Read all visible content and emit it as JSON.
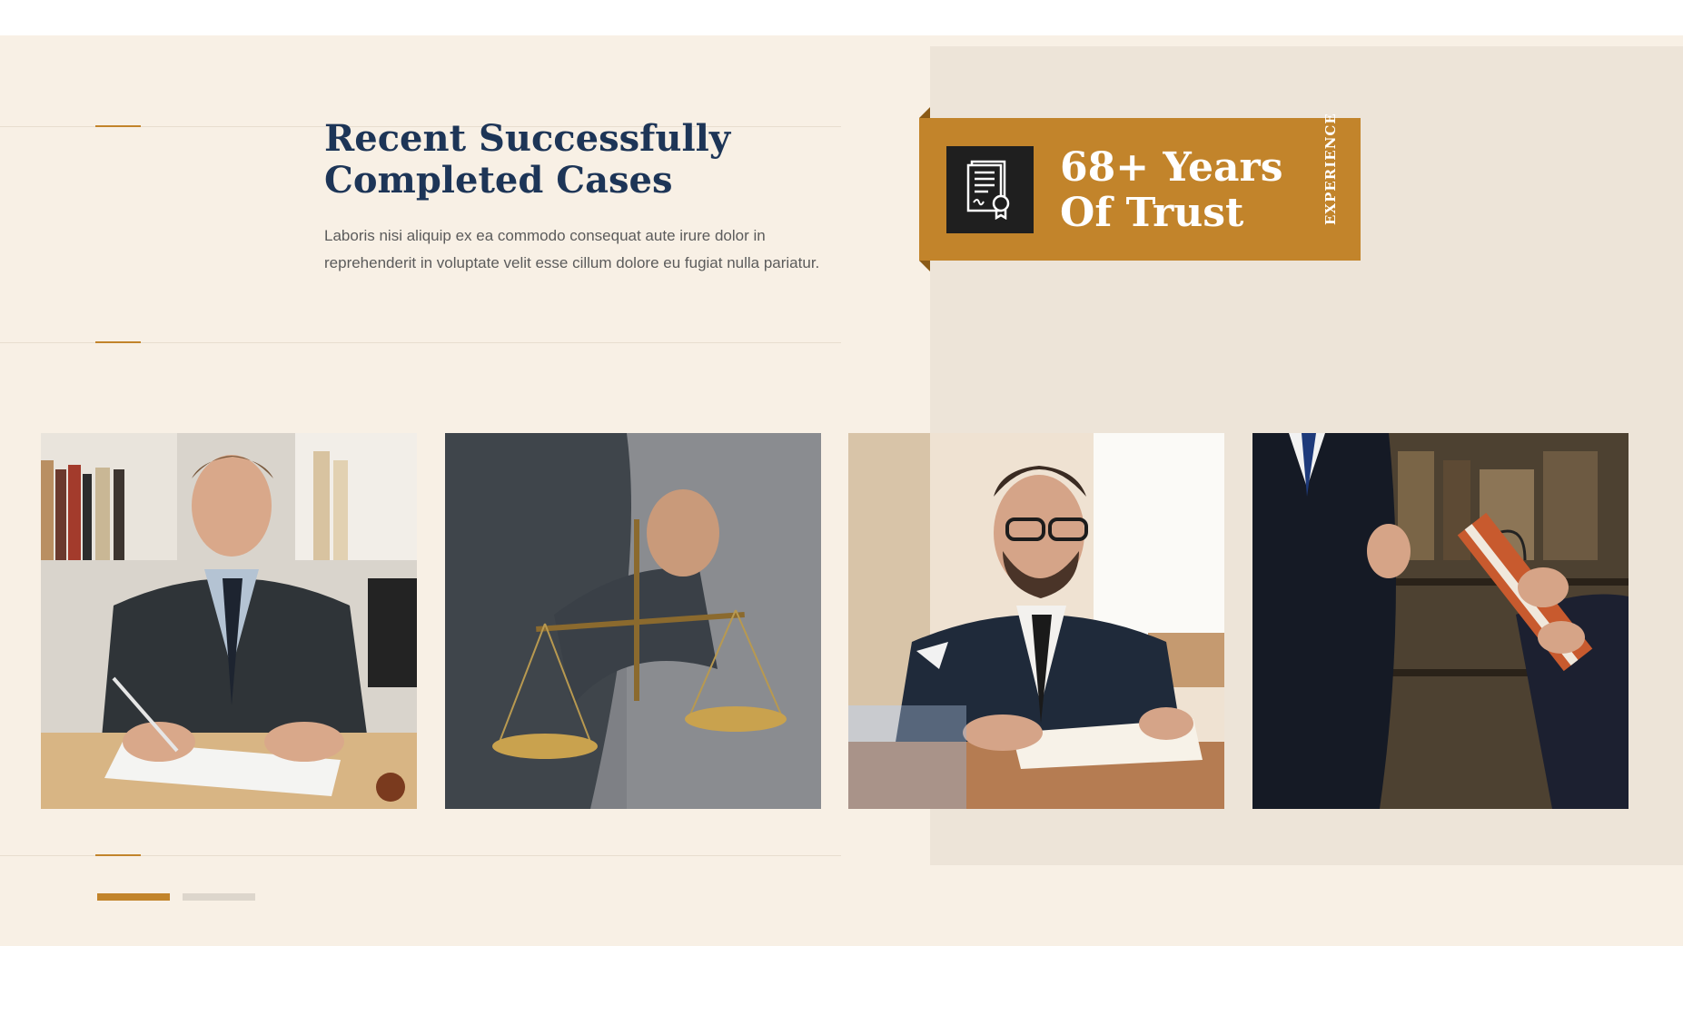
{
  "section": {
    "title": "Recent Successfully Completed Cases",
    "description": "Laboris nisi aliquip ex ea commodo consequat aute irure dolor in reprehenderit in voluptate velit esse cillum dolore eu fugiat nulla pariatur."
  },
  "badge": {
    "icon": "certificate-icon",
    "title": "68+ Years\nOf Trust",
    "vertical_label": "EXPERIENCE"
  },
  "gallery": {
    "photos": [
      {
        "name": "lawyer-signing-document"
      },
      {
        "name": "hand-holding-scales-of-justice"
      },
      {
        "name": "lawyer-writing-in-notebook"
      },
      {
        "name": "lawyers-holding-book"
      }
    ]
  },
  "slider": {
    "total_slides": 2,
    "active_slide": 1
  },
  "colors": {
    "accent": "#c2842b",
    "heading": "#1d3557",
    "background": "#f8f0e5",
    "panel": "#ede4d8"
  }
}
